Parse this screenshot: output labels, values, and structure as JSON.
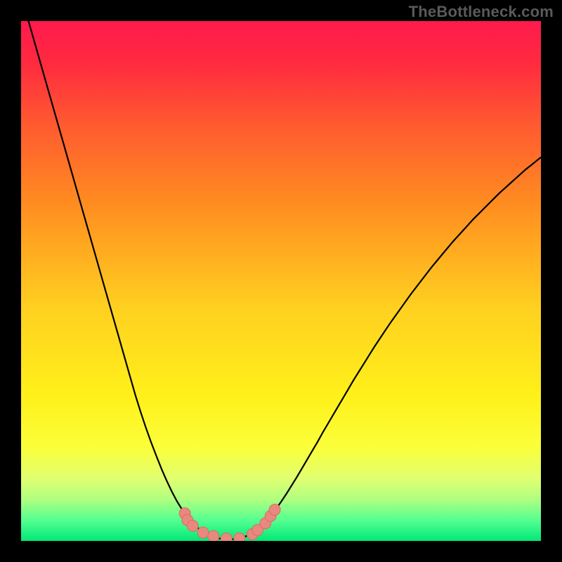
{
  "watermark": "TheBottleneck.com",
  "colors": {
    "frame": "#000000",
    "curve": "#000000",
    "marker_fill": "#e8887f",
    "marker_stroke": "#d86e63",
    "gradient_stops": [
      {
        "offset": 0.0,
        "color": "#ff1a4d"
      },
      {
        "offset": 0.08,
        "color": "#ff2a3f"
      },
      {
        "offset": 0.2,
        "color": "#ff5a30"
      },
      {
        "offset": 0.35,
        "color": "#ff8c20"
      },
      {
        "offset": 0.55,
        "color": "#ffd020"
      },
      {
        "offset": 0.72,
        "color": "#fff01a"
      },
      {
        "offset": 0.82,
        "color": "#fbff3a"
      },
      {
        "offset": 0.88,
        "color": "#e0ff70"
      },
      {
        "offset": 0.92,
        "color": "#b0ff80"
      },
      {
        "offset": 0.96,
        "color": "#55ff90"
      },
      {
        "offset": 1.0,
        "color": "#00e878"
      }
    ]
  },
  "chart_data": {
    "type": "line",
    "title": "",
    "xlabel": "",
    "ylabel": "",
    "xlim": [
      0,
      100
    ],
    "ylim": [
      0,
      100
    ],
    "x": [
      0,
      1,
      2,
      3,
      4,
      5,
      6,
      7,
      8,
      9,
      10,
      11,
      12,
      13,
      14,
      15,
      16,
      17,
      18,
      19,
      20,
      21,
      22,
      23,
      24,
      25,
      26,
      27,
      28,
      29,
      30,
      31,
      32,
      33,
      34,
      35,
      36,
      37,
      38,
      39,
      40,
      41,
      42,
      43,
      44,
      45,
      46,
      47,
      48,
      49,
      50,
      51,
      52,
      53,
      54,
      55,
      56,
      57,
      58,
      59,
      60,
      61,
      62,
      63,
      64,
      65,
      66,
      67,
      68,
      69,
      70,
      71,
      72,
      73,
      74,
      75,
      76,
      77,
      78,
      79,
      80,
      81,
      82,
      83,
      84,
      85,
      86,
      87,
      88,
      89,
      90,
      91,
      92,
      93,
      94,
      95,
      96,
      97,
      98,
      99,
      100
    ],
    "y": [
      105,
      101.5,
      98,
      94.5,
      91,
      87.5,
      84,
      80.5,
      77,
      73.5,
      70,
      66.5,
      63,
      59.5,
      56,
      52.5,
      49,
      45.5,
      42,
      38.5,
      35,
      31.5,
      28,
      24.8,
      21.8,
      19,
      16.4,
      13.9,
      11.6,
      9.5,
      7.6,
      6,
      4.6,
      3.4,
      2.5,
      1.8,
      1.2,
      0.8,
      0.5,
      0.35,
      0.3,
      0.35,
      0.5,
      0.8,
      1.2,
      1.8,
      2.6,
      3.6,
      4.8,
      6.1,
      7.5,
      9,
      10.6,
      12.2,
      13.9,
      15.6,
      17.3,
      19,
      20.8,
      22.5,
      24.2,
      25.9,
      27.6,
      29.3,
      31,
      32.6,
      34.2,
      35.8,
      37.4,
      38.9,
      40.4,
      41.9,
      43.3,
      44.7,
      46.1,
      47.5,
      48.8,
      50.1,
      51.4,
      52.7,
      53.9,
      55.1,
      56.3,
      57.5,
      58.6,
      59.7,
      60.8,
      61.9,
      62.9,
      63.9,
      64.9,
      65.9,
      66.9,
      67.8,
      68.7,
      69.6,
      70.5,
      71.4,
      72.2,
      73,
      73.8
    ],
    "markers": [
      {
        "x": 31.5,
        "y": 5.3
      },
      {
        "x": 32.0,
        "y": 4.0
      },
      {
        "x": 33.0,
        "y": 2.9
      },
      {
        "x": 35.0,
        "y": 1.6
      },
      {
        "x": 37.0,
        "y": 0.9
      },
      {
        "x": 39.5,
        "y": 0.45
      },
      {
        "x": 42.0,
        "y": 0.5
      },
      {
        "x": 44.5,
        "y": 1.3
      },
      {
        "x": 45.5,
        "y": 2.1
      },
      {
        "x": 47.0,
        "y": 3.4
      },
      {
        "x": 48.0,
        "y": 4.8
      },
      {
        "x": 48.8,
        "y": 6.0
      }
    ]
  }
}
